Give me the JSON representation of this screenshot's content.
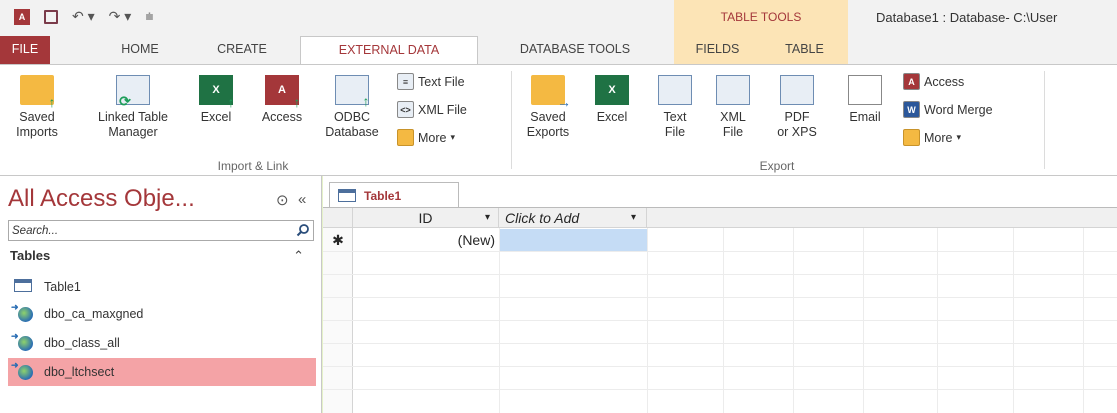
{
  "app": {
    "window_title": "Database1 : Database- C:\\User",
    "contextual_group": "TABLE TOOLS"
  },
  "tabs": [
    {
      "label": "FILE"
    },
    {
      "label": "HOME"
    },
    {
      "label": "CREATE"
    },
    {
      "label": "EXTERNAL DATA"
    },
    {
      "label": "DATABASE TOOLS"
    },
    {
      "label": "FIELDS"
    },
    {
      "label": "TABLE"
    }
  ],
  "import_link": {
    "group_label": "Import & Link",
    "saved_imports": [
      "Saved",
      "Imports"
    ],
    "linked_table_manager": [
      "Linked Table",
      "Manager"
    ],
    "excel": "Excel",
    "access": "Access",
    "odbc": [
      "ODBC",
      "Database"
    ],
    "text_file": "Text File",
    "xml_file": "XML File",
    "more": "More"
  },
  "export": {
    "group_label": "Export",
    "saved_exports": [
      "Saved",
      "Exports"
    ],
    "excel": "Excel",
    "text_file": [
      "Text",
      "File"
    ],
    "xml_file": [
      "XML",
      "File"
    ],
    "pdf_xps": [
      "PDF",
      "or XPS"
    ],
    "email": "Email",
    "access": "Access",
    "word_merge": "Word Merge",
    "more": "More"
  },
  "nav": {
    "title": "All Access Obje...",
    "search_placeholder": "Search...",
    "category": "Tables",
    "items": [
      {
        "label": "Table1",
        "icon": "table-icon"
      },
      {
        "label": "dbo_ca_maxgned",
        "icon": "linked-table-icon"
      },
      {
        "label": "dbo_class_all",
        "icon": "linked-table-icon"
      },
      {
        "label": "dbo_ltchsect",
        "icon": "linked-table-icon",
        "selected": true
      }
    ]
  },
  "document": {
    "tab_label": "Table1",
    "columns": [
      "ID",
      "Click to Add"
    ],
    "new_row_marker": "✱",
    "new_row_value": "(New)"
  },
  "colors": {
    "accent": "#a4373a",
    "contextual": "#fce4b6",
    "selected_item": "#f4a3a6",
    "background": "#e5f2c9"
  }
}
